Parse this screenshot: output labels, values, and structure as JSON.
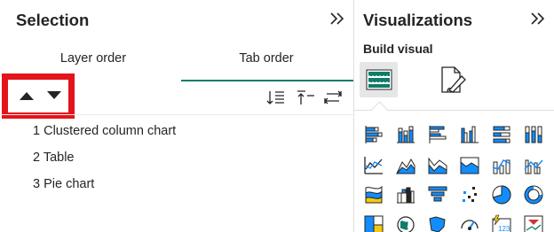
{
  "selection_pane": {
    "title": "Selection",
    "collapse_icon": "double-chevron-right-icon",
    "tabs": [
      {
        "label": "Layer order",
        "active": false
      },
      {
        "label": "Tab order",
        "active": true
      }
    ],
    "tools": [
      "move-up-icon",
      "move-down-icon",
      "sort-icon",
      "bring-to-front-icon",
      "tab-order-icon"
    ],
    "items": [
      {
        "label": "1 Clustered column chart"
      },
      {
        "label": "2 Table"
      },
      {
        "label": "3 Pie chart"
      }
    ]
  },
  "visualizations_pane": {
    "title": "Visualizations",
    "collapse_icon": "double-chevron-right-icon",
    "build_visual_label": "Build visual",
    "modes": [
      "build-visual-icon",
      "format-visual-icon"
    ],
    "visual_types": [
      "stacked-bar-chart",
      "stacked-column-chart",
      "clustered-bar-chart",
      "clustered-column-chart",
      "100-percent-stacked-bar-chart",
      "100-percent-stacked-column-chart",
      "line-chart",
      "area-chart",
      "stacked-area-chart",
      "100-percent-stacked-area-chart",
      "line-and-stacked-column-chart",
      "line-and-clustered-column-chart",
      "ribbon-chart",
      "waterfall-chart",
      "funnel-chart",
      "scatter-chart",
      "pie-chart",
      "donut-chart",
      "treemap",
      "map",
      "filled-map",
      "gauge",
      "card",
      "kpi"
    ],
    "visual_badge": "123"
  },
  "colors": {
    "accent_teal": "#107c6a",
    "highlight_red": "#e3141b",
    "icon_blue": "#118dff",
    "icon_dark": "#252423"
  }
}
